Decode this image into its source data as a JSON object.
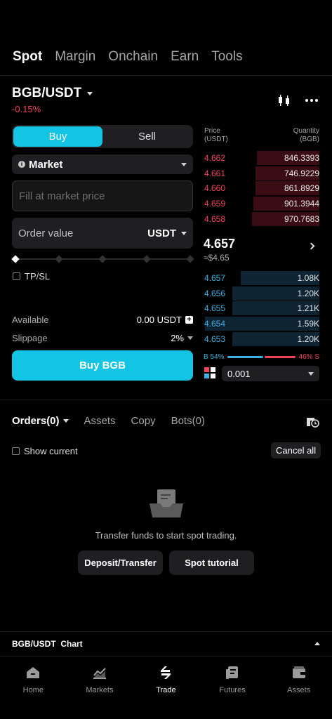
{
  "top_tabs": [
    {
      "label": "Spot",
      "active": true
    },
    {
      "label": "Margin"
    },
    {
      "label": "Onchain"
    },
    {
      "label": "Earn"
    },
    {
      "label": "Tools"
    }
  ],
  "pair": {
    "name": "BGB/USDT",
    "change": "-0.15%"
  },
  "trade_form": {
    "side_buy": "Buy",
    "side_sell": "Sell",
    "order_type": "Market",
    "price_placeholder": "Fill at market price",
    "order_value_label": "Order value",
    "order_value_unit": "USDT",
    "tpsl_label": "TP/SL",
    "available_label": "Available",
    "available_value": "0.00 USDT",
    "slippage_label": "Slippage",
    "slippage_value": "2%",
    "buy_button": "Buy BGB"
  },
  "orderbook": {
    "price_header": "Price\n(USDT)",
    "qty_header": "Quantity\n(BGB)",
    "asks": [
      {
        "price": "4.662",
        "qty": "846.3393",
        "depth": 0.54
      },
      {
        "price": "4.661",
        "qty": "746.9229",
        "depth": 0.55
      },
      {
        "price": "4.660",
        "qty": "861.8929",
        "depth": 0.55
      },
      {
        "price": "4.659",
        "qty": "901.3944",
        "depth": 0.57
      },
      {
        "price": "4.658",
        "qty": "970.7683",
        "depth": 0.58
      }
    ],
    "last_price": "4.657",
    "last_price_usd": "≈$4.65",
    "bids": [
      {
        "price": "4.657",
        "qty": "1.08K",
        "depth": 0.68
      },
      {
        "price": "4.656",
        "qty": "1.20K",
        "depth": 0.75
      },
      {
        "price": "4.655",
        "qty": "1.21K",
        "depth": 0.75
      },
      {
        "price": "4.654",
        "qty": "1.59K",
        "depth": 0.99
      },
      {
        "price": "4.653",
        "qty": "1.20K",
        "depth": 0.75
      }
    ],
    "buy_ratio": "B 54%",
    "sell_ratio": "46% S",
    "precision": "0.001"
  },
  "orders": {
    "tabs": [
      "Orders(0)",
      "Assets",
      "Copy",
      "Bots(0)"
    ],
    "show_current": "Show current",
    "cancel_all": "Cancel all",
    "empty_text": "Transfer funds to start spot trading.",
    "deposit_button": "Deposit/Transfer",
    "tutorial_button": "Spot tutorial"
  },
  "chart_bar": {
    "label": "BGB/USDT  Chart"
  },
  "bottom_nav": [
    {
      "label": "Home",
      "icon": "home-icon"
    },
    {
      "label": "Markets",
      "icon": "markets-icon"
    },
    {
      "label": "Trade",
      "icon": "trade-icon",
      "active": true
    },
    {
      "label": "Futures",
      "icon": "futures-icon"
    },
    {
      "label": "Assets",
      "icon": "wallet-icon"
    }
  ],
  "colors": {
    "accent": "#14c4e4",
    "ask": "#f0445a",
    "bid": "#3fb0e0"
  }
}
